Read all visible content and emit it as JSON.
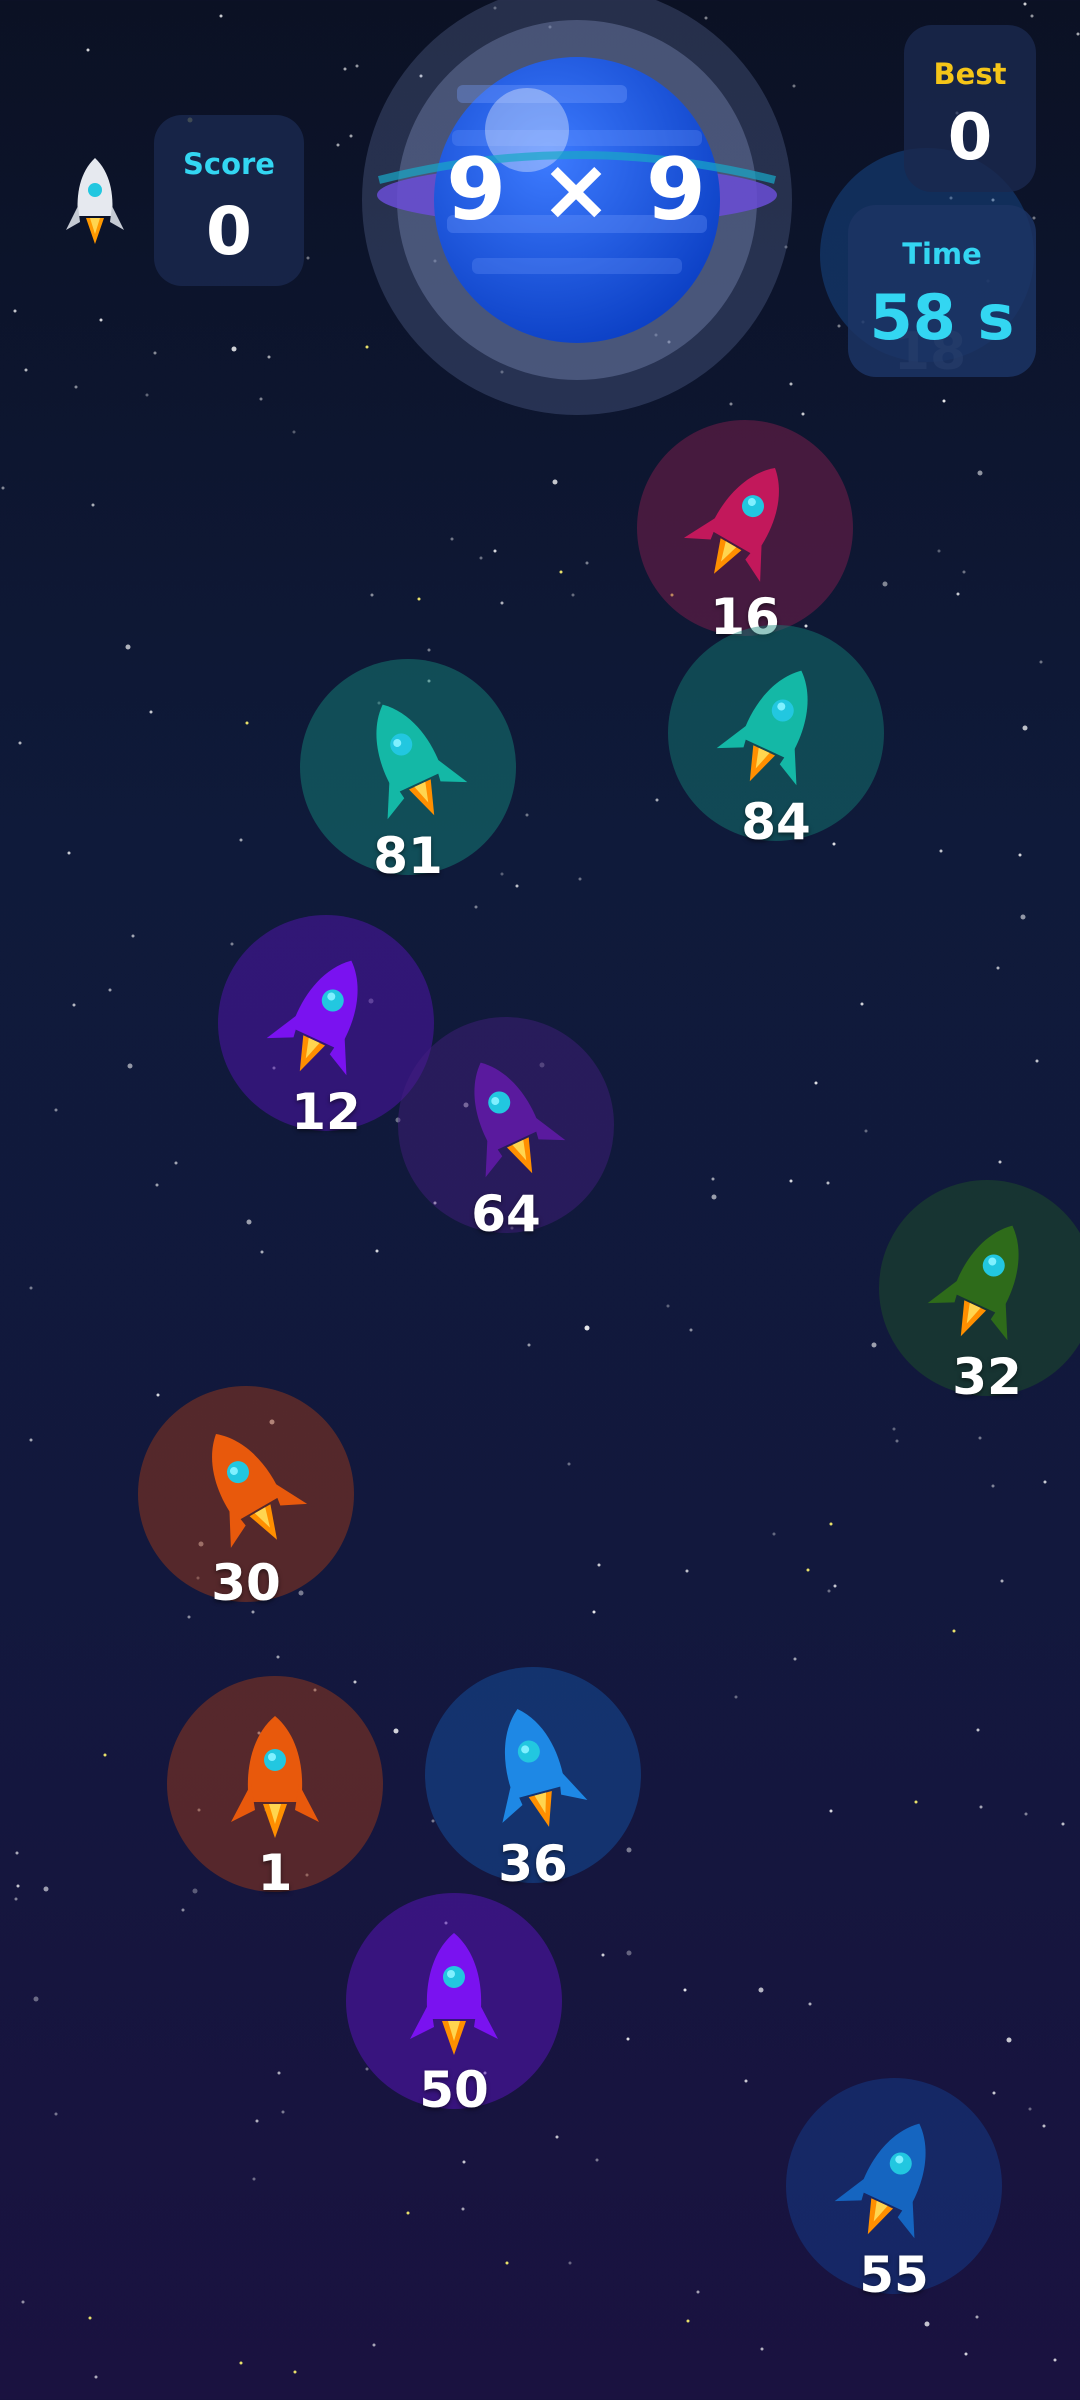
{
  "hud": {
    "score_label": "Score",
    "score_value": "0",
    "best_label": "Best",
    "best_value": "0",
    "time_label": "Time",
    "time_value": "58 s"
  },
  "question": "9 × 9",
  "ghost_answer": "18",
  "colors": {
    "accent_cyan": "#33d6f2",
    "best_gold": "#f5c518"
  },
  "rockets": [
    {
      "value": "16",
      "color": "#c2185b",
      "bubble": "rgba(140,30,80,0.45)",
      "rotation": 30
    },
    {
      "value": "84",
      "color": "#14b8a6",
      "bubble": "rgba(20,130,120,0.45)",
      "rotation": 25
    },
    {
      "value": "81",
      "color": "#14b8a6",
      "bubble": "rgba(20,130,120,0.5)",
      "rotation": -25
    },
    {
      "value": "12",
      "color": "#7a12f0",
      "bubble": "rgba(90,20,190,0.45)",
      "rotation": 25
    },
    {
      "value": "64",
      "color": "#5a1a9e",
      "bubble": "rgba(70,30,130,0.45)",
      "rotation": -25
    },
    {
      "value": "32",
      "color": "#2e6b1a",
      "bubble": "rgba(30,80,40,0.5)",
      "rotation": 25
    },
    {
      "value": "30",
      "color": "#e8590c",
      "bubble": "rgba(140,55,30,0.55)",
      "rotation": -30
    },
    {
      "value": "1",
      "color": "#e8590c",
      "bubble": "rgba(140,55,30,0.55)",
      "rotation": 0
    },
    {
      "value": "36",
      "color": "#1e88e5",
      "bubble": "rgba(20,80,160,0.5)",
      "rotation": -15
    },
    {
      "value": "50",
      "color": "#7a12f0",
      "bubble": "rgba(90,20,190,0.5)",
      "rotation": 0
    },
    {
      "value": "55",
      "color": "#1565c0",
      "bubble": "rgba(20,60,140,0.5)",
      "rotation": 25
    }
  ]
}
